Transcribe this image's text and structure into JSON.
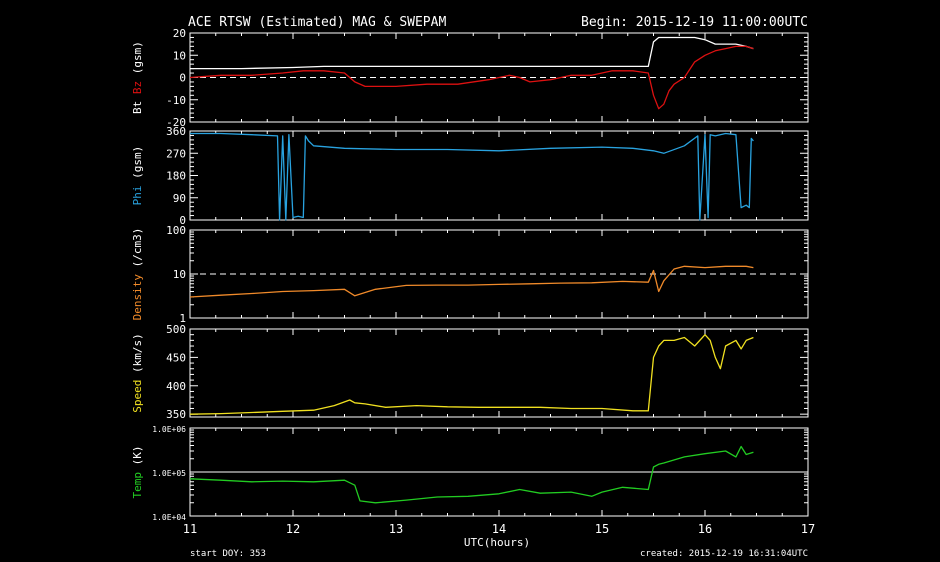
{
  "title": "ACE RTSW (Estimated) MAG & SWEPAM",
  "begin": "Begin: 2015-12-19 11:00:00UTC",
  "footer_left": "start DOY: 353",
  "footer_right": "created: 2015-12-19 16:31:04UTC",
  "xlabel": "UTC(hours)",
  "colors": {
    "background": "#000000",
    "axes": "#ffffff",
    "bt": "#ffffff",
    "bz": "#dd1111",
    "phi": "#29a3e0",
    "density": "#f08a2a",
    "speed": "#f0e020",
    "temp": "#22cc22"
  },
  "chart_data": [
    {
      "type": "line",
      "panel": "mag",
      "ylabel_parts": [
        "Bt",
        "Bz",
        "(gsm)"
      ],
      "ylim": [
        -20,
        20
      ],
      "yticks": [
        20,
        10,
        0,
        -10,
        -20
      ],
      "xlim": [
        11,
        17
      ],
      "xticks": [
        11,
        12,
        13,
        14,
        15,
        16,
        17
      ],
      "reference_line": {
        "y": 0,
        "style": "dashed"
      },
      "series": [
        {
          "name": "Bt",
          "color_key": "bt",
          "x": [
            11.0,
            11.5,
            12.0,
            12.3,
            12.6,
            13.0,
            13.5,
            14.0,
            14.5,
            15.0,
            15.45,
            15.5,
            15.55,
            15.6,
            15.7,
            15.8,
            15.9,
            16.0,
            16.1,
            16.2,
            16.3,
            16.4,
            16.47
          ],
          "y": [
            4,
            4,
            4.5,
            5,
            5,
            5,
            5,
            5,
            5,
            5,
            5,
            16,
            18,
            18,
            18,
            18,
            18,
            17,
            15,
            15,
            15,
            14,
            13
          ]
        },
        {
          "name": "Bz",
          "color_key": "bz",
          "x": [
            11.0,
            11.3,
            11.6,
            11.9,
            12.1,
            12.3,
            12.5,
            12.6,
            12.7,
            13.0,
            13.3,
            13.6,
            13.9,
            14.1,
            14.2,
            14.3,
            14.5,
            14.7,
            14.9,
            15.1,
            15.3,
            15.45,
            15.5,
            15.55,
            15.6,
            15.65,
            15.7,
            15.8,
            15.9,
            16.0,
            16.1,
            16.2,
            16.3,
            16.4,
            16.47
          ],
          "y": [
            0,
            1,
            1,
            2,
            3,
            3,
            2,
            -2,
            -4,
            -4,
            -3,
            -3,
            -1,
            1,
            0,
            -2,
            -1,
            1,
            1,
            3,
            3,
            2,
            -8,
            -14,
            -12,
            -6,
            -3,
            0,
            7,
            10,
            12,
            13,
            14,
            14,
            13
          ]
        }
      ]
    },
    {
      "type": "line",
      "panel": "phi",
      "ylabel_parts": [
        "Phi",
        "(gsm)"
      ],
      "ylim": [
        0,
        360
      ],
      "yticks": [
        360,
        270,
        180,
        90,
        0
      ],
      "xlim": [
        11,
        17
      ],
      "xticks": [
        11,
        12,
        13,
        14,
        15,
        16,
        17
      ],
      "series": [
        {
          "name": "Phi",
          "color_key": "phi",
          "x": [
            11.0,
            11.3,
            11.6,
            11.85,
            11.87,
            11.9,
            11.93,
            11.96,
            12.0,
            12.05,
            12.1,
            12.12,
            12.15,
            12.2,
            12.5,
            13.0,
            13.5,
            14.0,
            14.5,
            15.0,
            15.3,
            15.5,
            15.6,
            15.8,
            15.93,
            15.95,
            16.0,
            16.03,
            16.05,
            16.1,
            16.2,
            16.3,
            16.35,
            16.4,
            16.43,
            16.45,
            16.47
          ],
          "y": [
            350,
            350,
            345,
            340,
            0,
            340,
            0,
            345,
            10,
            15,
            10,
            340,
            320,
            300,
            290,
            285,
            285,
            280,
            290,
            295,
            290,
            280,
            270,
            300,
            340,
            0,
            345,
            10,
            345,
            340,
            350,
            345,
            50,
            60,
            50,
            330,
            320
          ]
        }
      ]
    },
    {
      "type": "line",
      "panel": "density",
      "ylabel_parts": [
        "Density",
        "(/cm3)"
      ],
      "yscale": "log",
      "ylim": [
        1,
        100
      ],
      "yticks": [
        100,
        10,
        1
      ],
      "xlim": [
        11,
        17
      ],
      "xticks": [
        11,
        12,
        13,
        14,
        15,
        16,
        17
      ],
      "reference_line": {
        "y": 10,
        "style": "dashed"
      },
      "series": [
        {
          "name": "Density",
          "color_key": "density",
          "x": [
            11.0,
            11.3,
            11.6,
            11.9,
            12.2,
            12.5,
            12.6,
            12.8,
            13.1,
            13.4,
            13.7,
            14.0,
            14.3,
            14.6,
            14.9,
            15.2,
            15.45,
            15.5,
            15.55,
            15.6,
            15.7,
            15.8,
            16.0,
            16.2,
            16.4,
            16.47
          ],
          "y": [
            3,
            3.3,
            3.6,
            4,
            4.2,
            4.5,
            3.2,
            4.5,
            5.5,
            5.6,
            5.6,
            5.8,
            6,
            6.2,
            6.3,
            6.8,
            6.5,
            12,
            4,
            7,
            13,
            15,
            14,
            15,
            15,
            14
          ]
        }
      ]
    },
    {
      "type": "line",
      "panel": "speed",
      "ylabel_parts": [
        "Speed",
        "(km/s)"
      ],
      "ylim": [
        345,
        500
      ],
      "yticks": [
        500,
        450,
        400,
        350
      ],
      "xlim": [
        11,
        17
      ],
      "xticks": [
        11,
        12,
        13,
        14,
        15,
        16,
        17
      ],
      "series": [
        {
          "name": "Speed",
          "color_key": "speed",
          "x": [
            11.0,
            11.3,
            11.6,
            11.9,
            12.2,
            12.4,
            12.55,
            12.6,
            12.7,
            12.9,
            13.2,
            13.5,
            13.8,
            14.1,
            14.4,
            14.7,
            15.0,
            15.3,
            15.45,
            15.5,
            15.55,
            15.6,
            15.7,
            15.8,
            15.9,
            16.0,
            16.05,
            16.1,
            16.15,
            16.2,
            16.3,
            16.35,
            16.4,
            16.47
          ],
          "y": [
            350,
            351,
            353,
            355,
            357,
            365,
            375,
            370,
            368,
            362,
            365,
            363,
            362,
            362,
            362,
            360,
            360,
            356,
            356,
            450,
            470,
            480,
            480,
            485,
            470,
            490,
            480,
            450,
            430,
            470,
            480,
            465,
            480,
            485
          ]
        }
      ]
    },
    {
      "type": "line",
      "panel": "temp",
      "ylabel_parts": [
        "Temp",
        "(K)"
      ],
      "yscale": "log",
      "ylim": [
        10000,
        1000000
      ],
      "yticks": [
        "1.0E+06",
        "1.0E+05",
        "1.0E+04"
      ],
      "xlim": [
        11,
        17
      ],
      "xticks": [
        11,
        12,
        13,
        14,
        15,
        16,
        17
      ],
      "reference_line": {
        "y": 100000,
        "style": "solid"
      },
      "series": [
        {
          "name": "Temp",
          "color_key": "temp",
          "x": [
            11.0,
            11.3,
            11.6,
            11.9,
            12.2,
            12.5,
            12.6,
            12.65,
            12.8,
            13.1,
            13.4,
            13.7,
            14.0,
            14.2,
            14.4,
            14.7,
            14.9,
            15.0,
            15.2,
            15.45,
            15.5,
            15.55,
            15.6,
            15.8,
            16.0,
            16.2,
            16.3,
            16.35,
            16.4,
            16.47
          ],
          "y": [
            70000,
            65000,
            60000,
            62000,
            60000,
            65000,
            50000,
            22000,
            20000,
            23000,
            27000,
            28000,
            32000,
            40000,
            33000,
            35000,
            28000,
            35000,
            45000,
            40000,
            130000,
            150000,
            160000,
            220000,
            260000,
            300000,
            220000,
            380000,
            250000,
            280000
          ]
        }
      ]
    }
  ]
}
